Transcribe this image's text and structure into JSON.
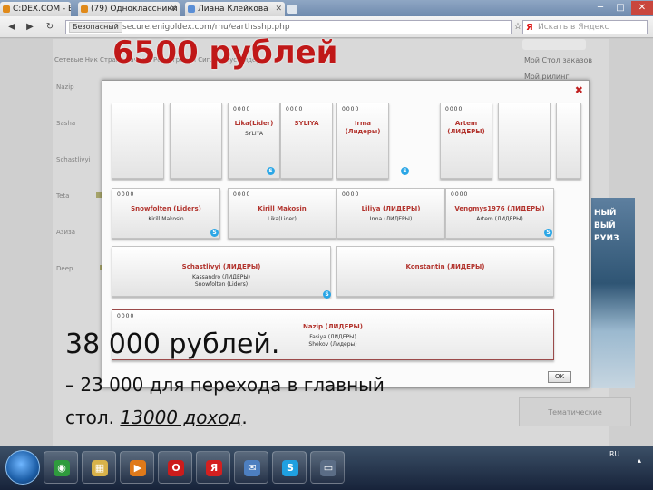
{
  "browser": {
    "tabs": [
      {
        "label": "C:DEX.COM - Бор..."
      },
      {
        "label": "(79) Одноклассники"
      },
      {
        "label": "Лиана Клейкова"
      }
    ],
    "address_tag": "Безопасный",
    "address_url": "secure.enigoldex.com/rnu/earthsshp.php",
    "search_placeholder": "Искать в Яндекс",
    "nav_back": "◀",
    "nav_forward": "▶",
    "reload": "↻",
    "star": "☆",
    "wrench": "⚙",
    "minimize": "─",
    "maximize": "□",
    "close": "✕"
  },
  "background_page": {
    "header": "Сетевые   Ник   Страна   Зачисл.   Регистрация   Сиг.   Статус   Лидер",
    "rows": [
      "Nazip",
      "Sasha",
      "Schastlivyi",
      "Teta",
      "Азиза",
      "Deep"
    ],
    "right_links": [
      "Мой Стол заказов",
      "Мой рилинг"
    ],
    "ad_text": "НЫЙ ВЫЙ РУИЗ",
    "tiles_label": "Тематические"
  },
  "modal": {
    "close_label": "✖",
    "dots": "0000",
    "row1": [
      {
        "name": "",
        "sub": ""
      },
      {
        "name": "",
        "sub": ""
      },
      {
        "name": "Lika(Lider)",
        "sub": "SYLIYA"
      },
      {
        "name": "SYLIYA",
        "sub": ""
      },
      {
        "name": "Irma (Лидеры)",
        "sub": ""
      },
      {
        "name": "Artem (ЛИДЕРЫ)",
        "sub": ""
      },
      {
        "name": "",
        "sub": ""
      },
      {
        "name": "",
        "sub": ""
      }
    ],
    "row2": [
      {
        "name": "Snowfolten (Liders)",
        "sub": "Kirill Makosin"
      },
      {
        "name": "Kirill Makosin",
        "sub": "Lika(Lider)"
      },
      {
        "name": "Liliya (ЛИДЕРЫ)",
        "sub": "Irma (ЛИДЕРЫ)"
      },
      {
        "name": "Vengmys1976 (ЛИДЕРЫ)",
        "sub": "Artem (ЛИДЕРЫ)"
      }
    ],
    "row3": [
      {
        "name": "Schastlivyi (ЛИДЕРЫ)",
        "sub1": "Kassandro (ЛИДЕРЫ)",
        "sub2": "Snowfolten (Liders)"
      },
      {
        "name": "Konstantin (ЛИДЕРЫ)",
        "sub1": "",
        "sub2": ""
      }
    ],
    "row4": {
      "name": "Nazip (ЛИДЕРЫ)",
      "sub1": "Fasiya (ЛИДЕРЫ)",
      "sub2": "Shekov (Лидеры)"
    },
    "ok_label": "OK"
  },
  "overlay": {
    "top_amount": "6500 рублей",
    "amount_38": "38 000 рублей.",
    "line1": "– 23 000 для перехода в главный",
    "line2_prefix": "стол. ",
    "line2_emph": "13000 доход",
    "line2_suffix": "."
  },
  "taskbar": {
    "apps": [
      {
        "icon": "chrome-icon",
        "glyph": "◉",
        "color": "#2f9b3d"
      },
      {
        "icon": "folder-icon",
        "glyph": "▦",
        "color": "#d8b24a"
      },
      {
        "icon": "media-player-icon",
        "glyph": "▶",
        "color": "#e07a1a"
      },
      {
        "icon": "opera-icon",
        "glyph": "O",
        "color": "#cc1c1c"
      },
      {
        "icon": "yandex-browser-icon",
        "glyph": "Я",
        "color": "#d42020"
      },
      {
        "icon": "mail-icon",
        "glyph": "✉",
        "color": "#4d7fc0"
      },
      {
        "icon": "skype-icon",
        "glyph": "S",
        "color": "#1fa0e0"
      },
      {
        "icon": "screen-icon",
        "glyph": "▭",
        "color": "#5b6d86"
      }
    ],
    "lang": "RU"
  }
}
